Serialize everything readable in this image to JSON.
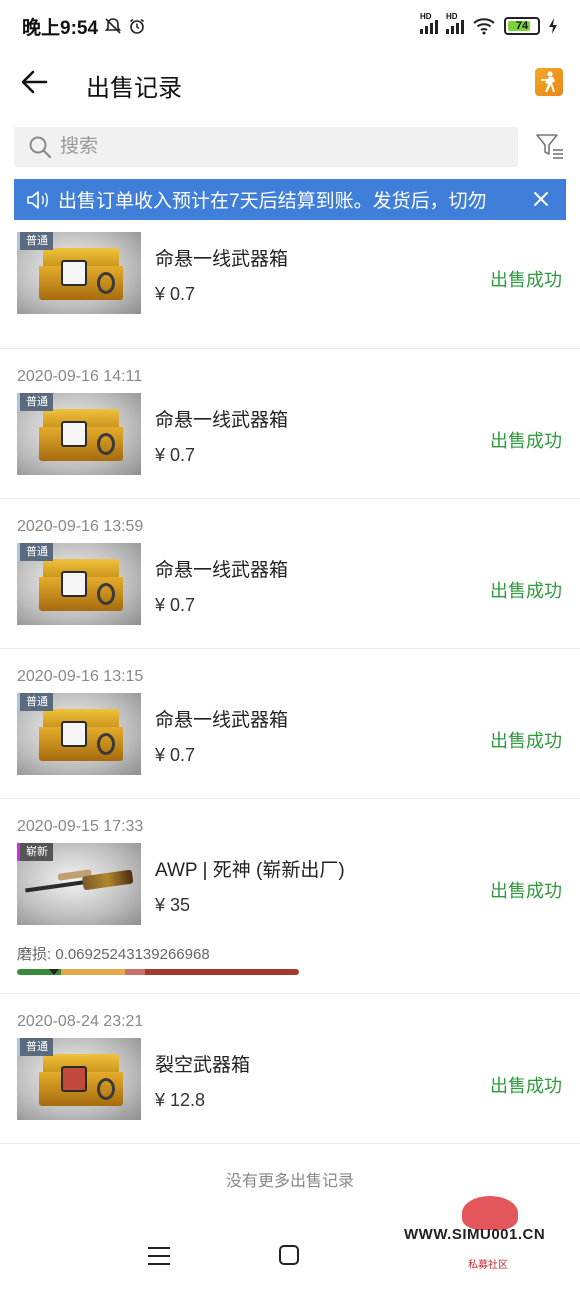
{
  "status_bar": {
    "time": "晚上9:54",
    "battery": "74",
    "signal_label": "HD"
  },
  "header": {
    "title": "出售记录"
  },
  "search": {
    "placeholder": "搜索"
  },
  "notice": {
    "text": "出售订单收入预计在7天后结算到账。发货后，切勿"
  },
  "records": [
    {
      "date": "",
      "tag": "普通",
      "name": "命悬一线武器箱",
      "price": "¥ 0.7",
      "status": "出售成功"
    },
    {
      "date": "2020-09-16 14:11",
      "tag": "普通",
      "name": "命悬一线武器箱",
      "price": "¥ 0.7",
      "status": "出售成功"
    },
    {
      "date": "2020-09-16 13:59",
      "tag": "普通",
      "name": "命悬一线武器箱",
      "price": "¥ 0.7",
      "status": "出售成功"
    },
    {
      "date": "2020-09-16 13:15",
      "tag": "普通",
      "name": "命悬一线武器箱",
      "price": "¥ 0.7",
      "status": "出售成功"
    },
    {
      "date": "2020-09-15 17:33",
      "tag": "崭新",
      "name": "AWP | 死神 (崭新出厂)",
      "price": "¥ 35",
      "status": "出售成功",
      "wear": "磨损: 0.06925243139266968"
    },
    {
      "date": "2020-08-24 23:21",
      "tag": "普通",
      "name": "裂空武器箱",
      "price": "¥ 12.8",
      "status": "出售成功"
    }
  ],
  "footer": {
    "no_more": "没有更多出售记录"
  },
  "watermark": {
    "site": "WWW.SIMU001.CN",
    "sub": "私募社区"
  },
  "colors": {
    "accent": "#3f7fd9",
    "success": "#2e9a3c"
  }
}
